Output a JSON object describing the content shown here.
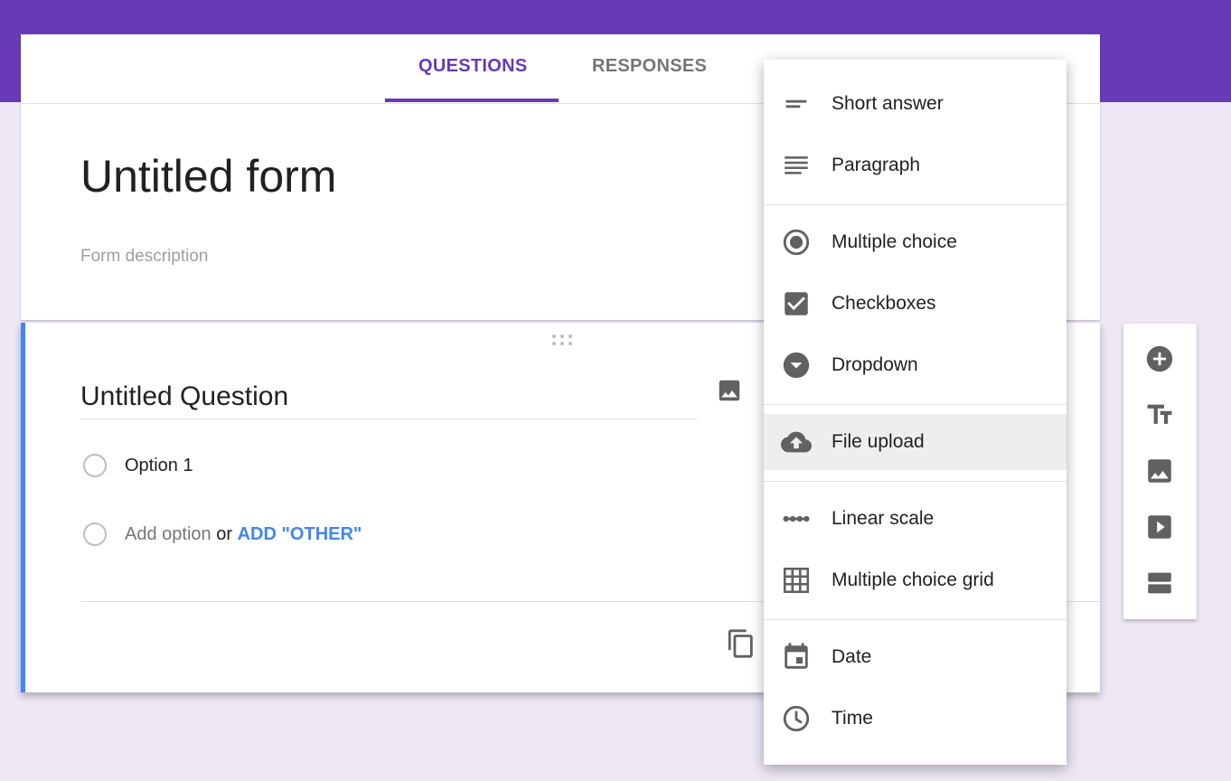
{
  "tabs": {
    "questions": "QUESTIONS",
    "responses": "RESPONSES"
  },
  "form": {
    "title": "Untitled form",
    "description_placeholder": "Form description"
  },
  "question": {
    "title": "Untitled Question",
    "option1": "Option 1",
    "add_option": "Add option",
    "or": "or",
    "add_other": "ADD \"OTHER\""
  },
  "menu": {
    "items": [
      {
        "label": "Short answer",
        "icon": "short-answer-icon"
      },
      {
        "label": "Paragraph",
        "icon": "paragraph-icon"
      },
      {
        "label": "Multiple choice",
        "icon": "radio-button-icon"
      },
      {
        "label": "Checkboxes",
        "icon": "checkbox-icon"
      },
      {
        "label": "Dropdown",
        "icon": "dropdown-icon"
      },
      {
        "label": "File upload",
        "icon": "cloud-upload-icon",
        "selected": true
      },
      {
        "label": "Linear scale",
        "icon": "linear-scale-icon"
      },
      {
        "label": "Multiple choice grid",
        "icon": "grid-icon"
      },
      {
        "label": "Date",
        "icon": "calendar-icon"
      },
      {
        "label": "Time",
        "icon": "clock-icon"
      }
    ]
  },
  "toolbar": {
    "icons": [
      "add-question-icon",
      "add-title-icon",
      "add-image-icon",
      "add-video-icon",
      "add-section-icon"
    ]
  },
  "colors": {
    "brand": "#673ab7",
    "background": "#ede7f6",
    "accent_blue": "#4285f4",
    "icon_grey": "#616161"
  }
}
